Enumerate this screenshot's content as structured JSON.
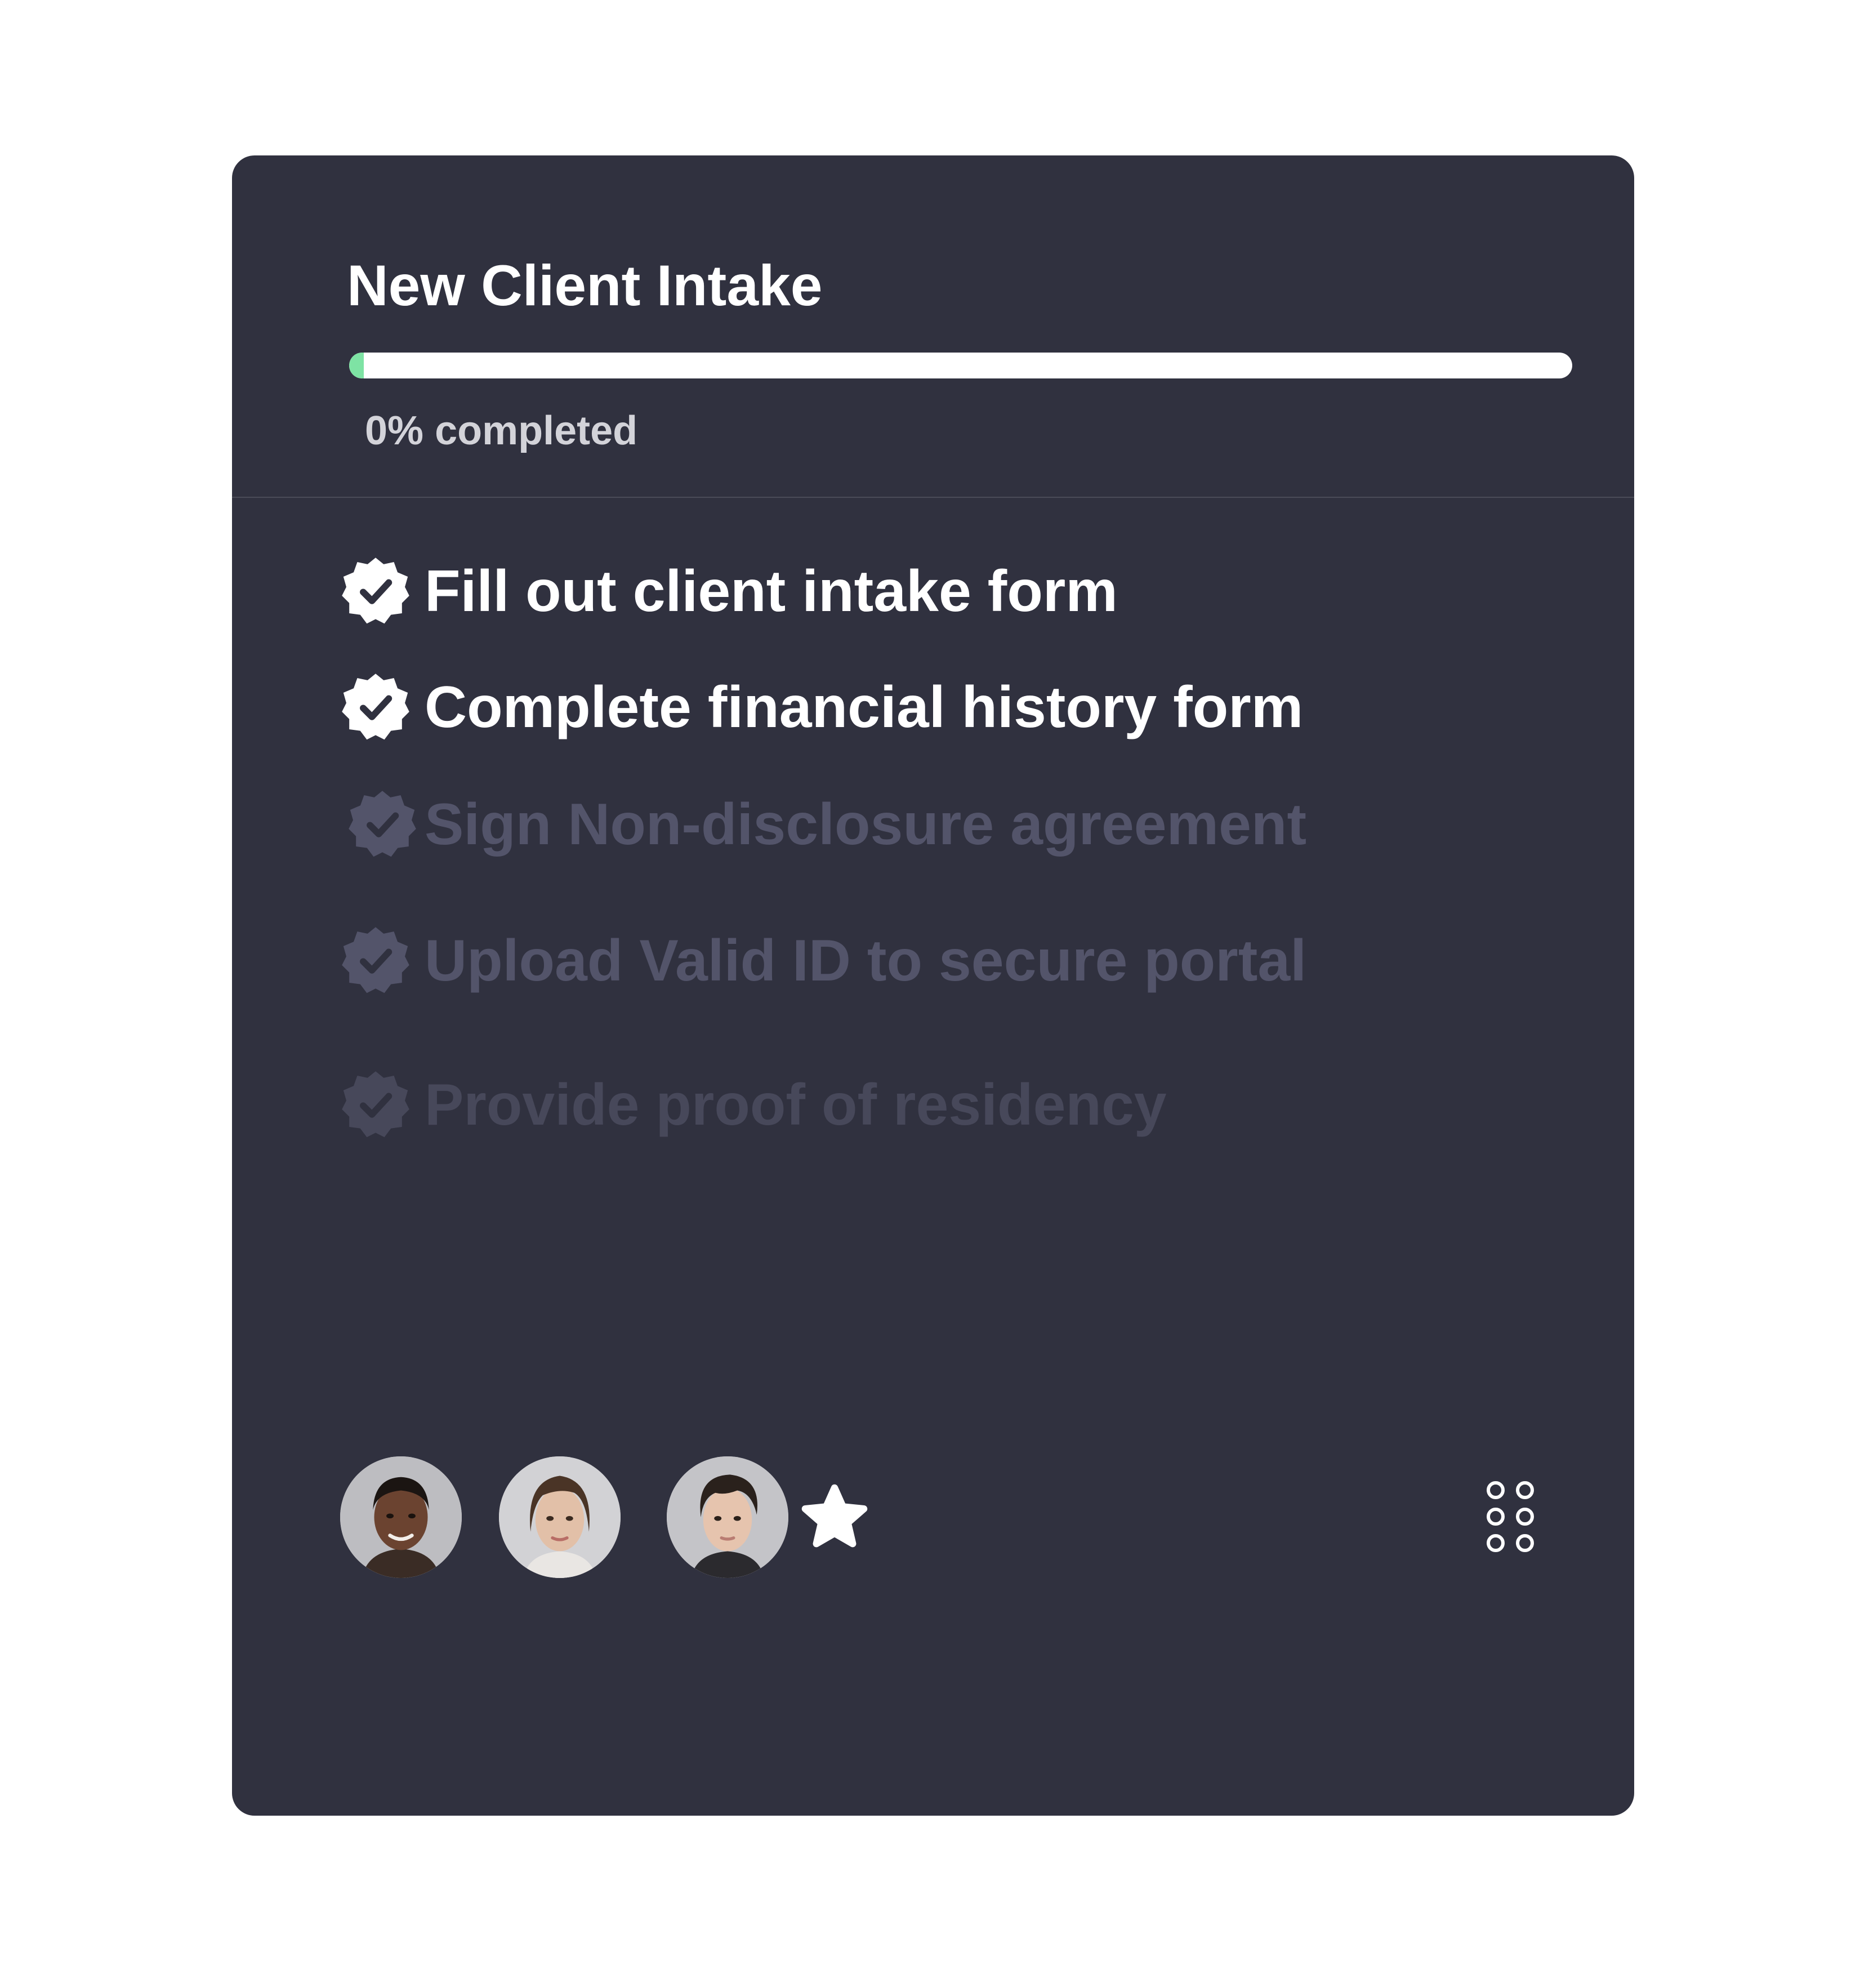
{
  "card": {
    "title": "New Client Intake",
    "progress": {
      "percent": 0,
      "label": "0% completed",
      "fill_color": "#7ee3a4"
    }
  },
  "tasks": [
    {
      "label": "Fill out client intake form",
      "status": "done"
    },
    {
      "label": "Complete financial history form",
      "status": "done"
    },
    {
      "label": "Sign Non-disclosure agreement",
      "status": "pending"
    },
    {
      "label": "Upload Valid ID to secure portal",
      "status": "pending"
    },
    {
      "label": "Provide proof of residency",
      "status": "pending"
    }
  ],
  "assignees": [
    {
      "name": "avatar-1",
      "skin": "#6b4330",
      "hair": "#1b1512"
    },
    {
      "name": "avatar-2",
      "skin": "#e2c0a8",
      "hair": "#4a3426"
    },
    {
      "name": "avatar-3",
      "skin": "#e6c4ae",
      "hair": "#2a211c"
    }
  ],
  "footer_icons": [
    "star-icon",
    "grid-icon"
  ],
  "colors": {
    "card_bg": "#30313f",
    "text_primary": "#ffffff",
    "text_muted": "#53546a"
  }
}
